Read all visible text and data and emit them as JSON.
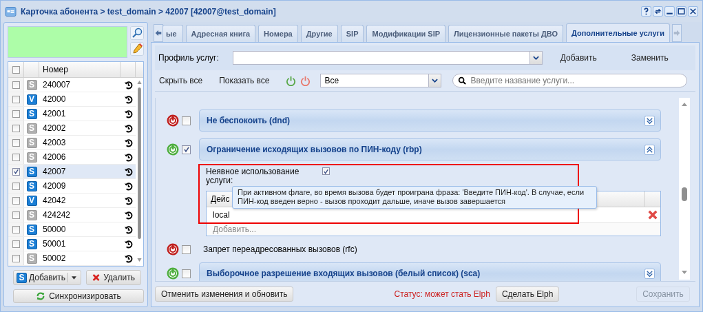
{
  "window": {
    "title": "Карточка абонента > test_domain > 42007 [42007@test_domain]"
  },
  "left_panel": {
    "numbers_header": "Номер",
    "all_checked": false,
    "numbers": [
      {
        "number": "240007",
        "badge": "S",
        "active": false,
        "checked": false
      },
      {
        "number": "42000",
        "badge": "V",
        "active": true,
        "checked": false
      },
      {
        "number": "42001",
        "badge": "S",
        "active": true,
        "checked": false
      },
      {
        "number": "42002",
        "badge": "S",
        "active": false,
        "checked": false
      },
      {
        "number": "42003",
        "badge": "S",
        "active": false,
        "checked": false
      },
      {
        "number": "42006",
        "badge": "S",
        "active": false,
        "checked": false
      },
      {
        "number": "42007",
        "badge": "S",
        "active": true,
        "checked": true
      },
      {
        "number": "42009",
        "badge": "S",
        "active": true,
        "checked": false
      },
      {
        "number": "42042",
        "badge": "V",
        "active": true,
        "checked": false
      },
      {
        "number": "424242",
        "badge": "S",
        "active": false,
        "checked": false
      },
      {
        "number": "50000",
        "badge": "S",
        "active": true,
        "checked": false
      },
      {
        "number": "50001",
        "badge": "S",
        "active": true,
        "checked": false
      },
      {
        "number": "50002",
        "badge": "S",
        "active": false,
        "checked": false
      }
    ],
    "add_button": {
      "label": "Добавить",
      "badge": "S"
    },
    "delete_button": "Удалить",
    "sync_button": "Синхронизировать"
  },
  "tabs": [
    {
      "label": "ые",
      "selected": false
    },
    {
      "label": "Адресная книга",
      "selected": false
    },
    {
      "label": "Номера",
      "selected": false
    },
    {
      "label": "Другие",
      "selected": false
    },
    {
      "label": "SIP",
      "selected": false
    },
    {
      "label": "Модификации SIP",
      "selected": false
    },
    {
      "label": "Лицензионные пакеты ДВО",
      "selected": false
    },
    {
      "label": "Дополнительные услуги",
      "selected": true
    }
  ],
  "profile": {
    "label": "Профиль услуг:",
    "add": "Добавить",
    "replace": "Заменить"
  },
  "toolbar": {
    "hide_all": "Скрыть все",
    "show_all": "Показать все",
    "filter_value": "Все",
    "search_placeholder": "Введите название услуги..."
  },
  "services": [
    {
      "kind": "panel",
      "name": "Не беспокоить (dnd)",
      "on": false,
      "checked": false,
      "expanded": false
    },
    {
      "kind": "panel",
      "name": "Ограничение исходящих вызовов по ПИН-коду (rbp)",
      "on": true,
      "checked": true,
      "expanded": true,
      "details": {
        "implicit_label": "Неявное использование услуги:",
        "implicit_checked": true,
        "table_header": "Дейс",
        "rows": [
          "local"
        ],
        "add_placeholder": "Добавить...",
        "tooltip": "При активном флаге, во время вызова будет проиграна фраза: 'Введите ПИН-код'. В случае, если ПИН-код введен верно - вызов проходит дальше, иначе вызов завершается"
      }
    },
    {
      "kind": "plain",
      "name": "Запрет переадресованных вызовов (rfc)",
      "on": false,
      "checked": false
    },
    {
      "kind": "panel",
      "name": "Выборочное разрешение входящих вызовов (белый список) (sca)",
      "on": true,
      "checked": false,
      "expanded": false
    }
  ],
  "footer": {
    "cancel_button": "Отменить изменения и обновить",
    "status": "Статус: может стать Elph",
    "elph_button": "Сделать Elph",
    "save_button": {
      "label": "Сохранить",
      "disabled": true
    }
  }
}
